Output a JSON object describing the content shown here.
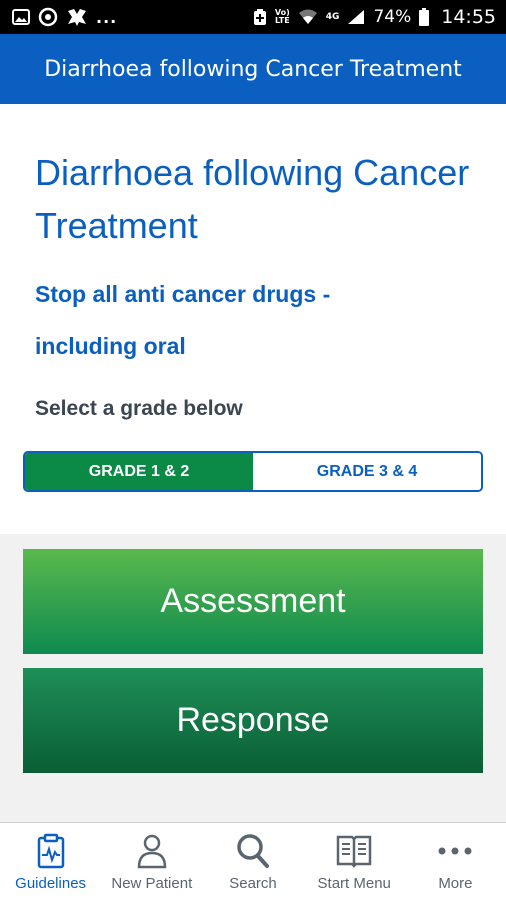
{
  "status_bar": {
    "lte_top": "Vo)",
    "lte_bottom": "LTE",
    "network": "4G",
    "battery": "74%",
    "time": "14:55",
    "dots": "..."
  },
  "app_bar": {
    "title": "Diarrhoea following Cancer Treatment"
  },
  "content": {
    "title": "Diarrhoea following Cancer Treatment",
    "subtitle": "Stop all anti cancer drugs - including oral",
    "select_label": "Select a grade below",
    "grades": [
      {
        "label": "GRADE 1 & 2",
        "selected": true
      },
      {
        "label": "GRADE 3 & 4",
        "selected": false
      }
    ]
  },
  "buttons": {
    "assessment": "Assessment",
    "response": "Response"
  },
  "bottom_nav": [
    {
      "label": "Guidelines",
      "icon": "clipboard-ecg-icon",
      "active": true
    },
    {
      "label": "New Patient",
      "icon": "person-icon",
      "active": false
    },
    {
      "label": "Search",
      "icon": "search-icon",
      "active": false
    },
    {
      "label": "Start Menu",
      "icon": "book-icon",
      "active": false
    },
    {
      "label": "More",
      "icon": "more-dots-icon",
      "active": false
    }
  ],
  "colors": {
    "primary_blue": "#0a5fc0",
    "selected_green": "#0a8a44",
    "assessment_green": "#3fa84a",
    "response_green": "#0d7040"
  }
}
